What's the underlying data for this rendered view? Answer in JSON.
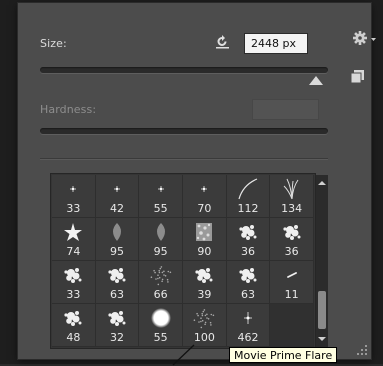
{
  "brush_panel": {
    "size_label": "Size:",
    "size_value": "2448 px",
    "size_slider_fraction": 0.96,
    "hardness_label": "Hardness:",
    "hardness_value": "",
    "hardness_disabled": true
  },
  "icons": {
    "reset": "reset-size-icon",
    "gear": "gear-menu-icon",
    "new_preset": "new-preset-icon"
  },
  "presets": [
    {
      "size": "33",
      "kind": "star-small"
    },
    {
      "size": "42",
      "kind": "star-small"
    },
    {
      "size": "55",
      "kind": "star-small"
    },
    {
      "size": "70",
      "kind": "star-small"
    },
    {
      "size": "112",
      "kind": "streak"
    },
    {
      "size": "134",
      "kind": "grass"
    },
    {
      "size": "74",
      "kind": "star"
    },
    {
      "size": "95",
      "kind": "leaf"
    },
    {
      "size": "95",
      "kind": "leaf"
    },
    {
      "size": "90",
      "kind": "texture"
    },
    {
      "size": "36",
      "kind": "splat"
    },
    {
      "size": "36",
      "kind": "splat"
    },
    {
      "size": "33",
      "kind": "splat"
    },
    {
      "size": "63",
      "kind": "splat"
    },
    {
      "size": "66",
      "kind": "spray"
    },
    {
      "size": "39",
      "kind": "splat"
    },
    {
      "size": "63",
      "kind": "splat"
    },
    {
      "size": "11",
      "kind": "dash"
    },
    {
      "size": "48",
      "kind": "splat"
    },
    {
      "size": "32",
      "kind": "splat"
    },
    {
      "size": "55",
      "kind": "soft-round"
    },
    {
      "size": "100",
      "kind": "spray"
    },
    {
      "size": "462",
      "kind": "flare"
    },
    {
      "size": "",
      "kind": "empty"
    }
  ],
  "tooltip": "Movie Prime Flare",
  "colors": {
    "panel": "#4c4c4c",
    "tooltip_bg": "#ffffe1"
  }
}
